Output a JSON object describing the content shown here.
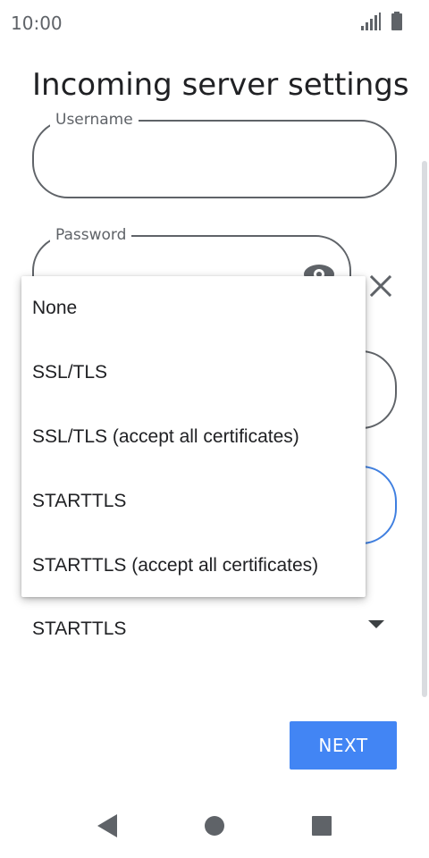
{
  "status_bar": {
    "time": "10:00"
  },
  "page": {
    "title": "Incoming server settings"
  },
  "fields": {
    "username": {
      "label": "Username",
      "value": ""
    },
    "password": {
      "label": "Password",
      "value": ""
    }
  },
  "security": {
    "selected": "STARTTLS"
  },
  "dropdown": {
    "options": [
      "None",
      "SSL/TLS",
      "SSL/TLS (accept all certificates)",
      "STARTTLS",
      "STARTTLS (accept all certificates)"
    ]
  },
  "buttons": {
    "next": "NEXT"
  },
  "colors": {
    "accent": "#4285f4",
    "focus_outline": "#3f7fe0",
    "outline": "#5f6368"
  }
}
